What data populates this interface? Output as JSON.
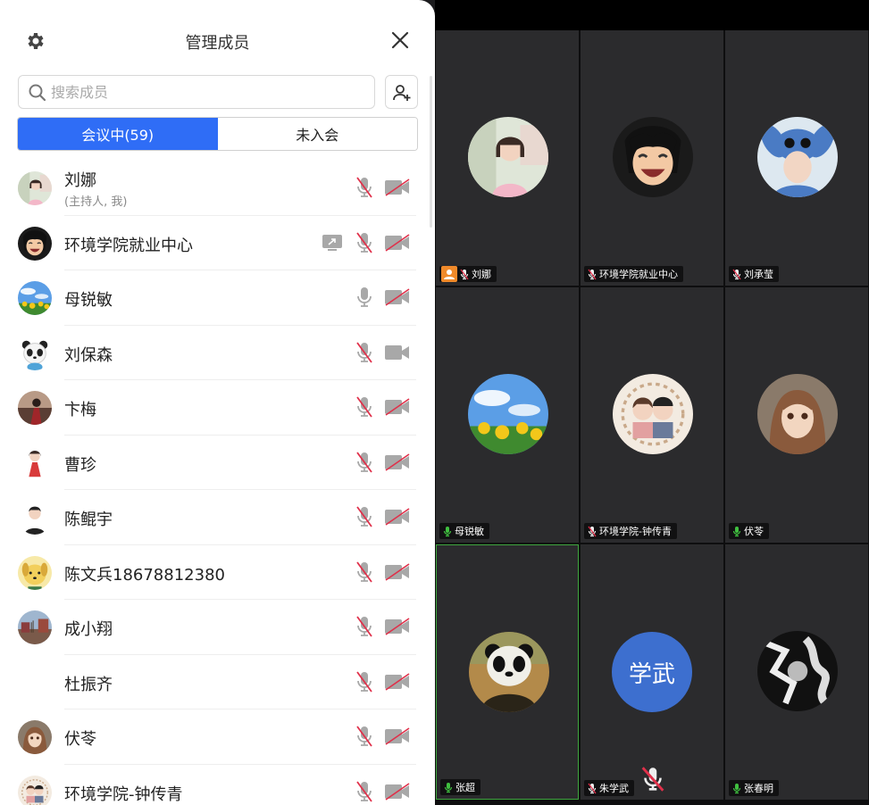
{
  "panel": {
    "title": "管理成员",
    "search_placeholder": "搜索成员",
    "tabs": [
      {
        "label": "会议中(59)",
        "active": true
      },
      {
        "label": "未入会",
        "active": false
      }
    ],
    "members": [
      {
        "name": "刘娜",
        "sub": "(主持人, 我)",
        "avatar": "woman-illustration",
        "mic_muted": true,
        "cam_off": true,
        "sharing": false
      },
      {
        "name": "环境学院就业中心",
        "sub": "",
        "avatar": "anime-laugh",
        "mic_muted": true,
        "cam_off": true,
        "sharing": true
      },
      {
        "name": "母锐敏",
        "sub": "",
        "avatar": "sunflowers",
        "mic_muted": false,
        "cam_off": true,
        "sharing": false
      },
      {
        "name": "刘保森",
        "sub": "",
        "avatar": "panda-cartoon",
        "mic_muted": true,
        "cam_off": false,
        "sharing": false
      },
      {
        "name": "卞梅",
        "sub": "",
        "avatar": "photo-dark",
        "mic_muted": true,
        "cam_off": true,
        "sharing": false
      },
      {
        "name": "曹珍",
        "sub": "",
        "avatar": "girl-red-dress",
        "mic_muted": true,
        "cam_off": true,
        "sharing": false
      },
      {
        "name": "陈鲲宇",
        "sub": "",
        "avatar": "boy-cartoon",
        "mic_muted": true,
        "cam_off": true,
        "sharing": false
      },
      {
        "name": "陈文兵18678812380",
        "sub": "",
        "avatar": "yellow-dog",
        "mic_muted": true,
        "cam_off": true,
        "sharing": false
      },
      {
        "name": "成小翔",
        "sub": "",
        "avatar": "campus-photo",
        "mic_muted": true,
        "cam_off": true,
        "sharing": false
      },
      {
        "name": "杜振齐",
        "sub": "",
        "avatar": "none",
        "mic_muted": true,
        "cam_off": true,
        "sharing": false
      },
      {
        "name": "伏苓",
        "sub": "",
        "avatar": "anime-girl",
        "mic_muted": true,
        "cam_off": true,
        "sharing": false
      },
      {
        "name": "环境学院-钟传青",
        "sub": "",
        "avatar": "couple-cartoon",
        "mic_muted": true,
        "cam_off": true,
        "sharing": false
      }
    ]
  },
  "grid": {
    "tiles": [
      {
        "name": "刘娜",
        "avatar": "woman-illustration",
        "host": true,
        "mic_muted": true,
        "active": false
      },
      {
        "name": "环境学院就业中心",
        "avatar": "anime-laugh",
        "host": false,
        "mic_muted": true,
        "active": false
      },
      {
        "name": "刘承莹",
        "avatar": "stitch-boy",
        "host": false,
        "mic_muted": true,
        "active": false
      },
      {
        "name": "母锐敏",
        "avatar": "sunflowers",
        "host": false,
        "mic_muted": false,
        "active": false
      },
      {
        "name": "环境学院-钟传青",
        "avatar": "couple-cartoon",
        "host": false,
        "mic_muted": true,
        "active": false
      },
      {
        "name": "伏苓",
        "avatar": "anime-girl",
        "host": false,
        "mic_muted": false,
        "active": false
      },
      {
        "name": "张超",
        "avatar": "panda-portrait",
        "host": false,
        "mic_muted": false,
        "active": true
      },
      {
        "name": "朱学武",
        "initials": "学武",
        "host": false,
        "mic_muted": true,
        "active": false
      },
      {
        "name": "张春明",
        "avatar": "bw-art",
        "host": false,
        "mic_muted": false,
        "active": false
      }
    ]
  },
  "colors": {
    "accent": "#2f6df6",
    "muted_red": "#e0304a",
    "active_border": "#3fa63f",
    "host_badge": "#f08a2a"
  }
}
